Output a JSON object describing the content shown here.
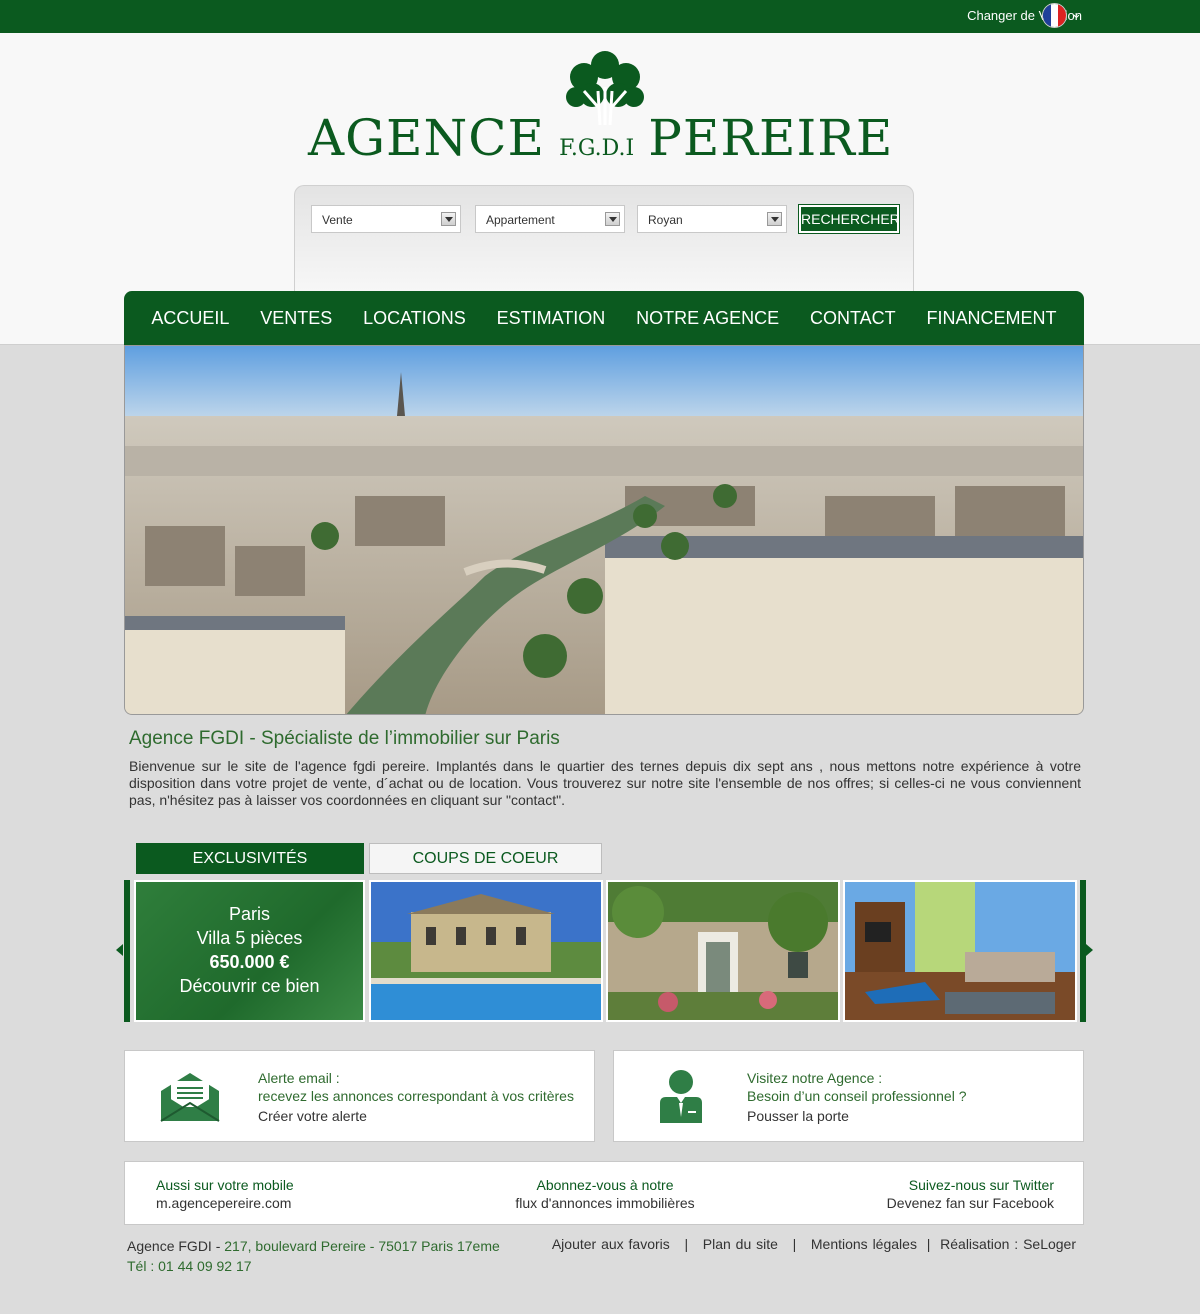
{
  "topbar": {
    "version_label": "Changer de Version"
  },
  "logo": {
    "left": "AGENCE",
    "middle": "F.G.D.I",
    "right": "PEREIRE"
  },
  "search": {
    "transaction": "Vente",
    "property_type": "Appartement",
    "city": "Royan",
    "button": "RECHERCHER"
  },
  "nav": [
    "ACCUEIL",
    "VENTES",
    "LOCATIONS",
    "ESTIMATION",
    "NOTRE AGENCE",
    "CONTACT",
    "FINANCEMENT"
  ],
  "intro": {
    "title": "Agence FGDI - Spécialiste de l’immobilier sur Paris",
    "text": "Bienvenue sur le site de l'agence fgdi pereire. Implantés dans le quartier des ternes depuis dix sept ans , nous mettons notre expérience à votre disposition dans votre projet de vente, d´achat ou de location. Vous trouverez sur notre site l'ensemble de nos offres; si celles-ci ne vous conviennent pas, n'hésitez pas à laisser vos coordonnées en cliquant sur \"contact\"."
  },
  "tabs": {
    "active": "EXCLUSIVITÉS",
    "inactive": "COUPS DE COEUR"
  },
  "featured": {
    "city": "Paris",
    "type": "Villa 5 pièces",
    "price": "650.000 €",
    "cta": "Découvrir ce bien"
  },
  "alert_box": {
    "title": "Alerte email :",
    "line2": "recevez les annonces correspondant à vos critères",
    "line3": "Créer votre alerte"
  },
  "agency_box": {
    "title": "Visitez notre Agence :",
    "line2": "Besoin d’un conseil professionnel ?",
    "line3": "Pousser la porte"
  },
  "strip": {
    "mobile_title": "Aussi sur votre mobile",
    "mobile_url": "m.agencepereire.com",
    "rss_title": "Abonnez-vous à notre",
    "rss_text": "flux d'annonces immobilières",
    "twitter": "Suivez-nous sur Twitter",
    "facebook": "Devenez fan sur Facebook"
  },
  "footer": {
    "agency": "Agence FGDI - ",
    "address": "217, boulevard Pereire - 75017 Paris 17eme",
    "phone": "Tél : 01 44 09 92 17",
    "links": "Ajouter aux favoris   |   Plan du site   |   Mentions légales  |  Réalisation : SeLoger"
  },
  "colors": {
    "brand_green": "#0b5a1f",
    "text_green": "#2f6b2f"
  },
  "icons": [
    "flag-fr-icon",
    "chevron-down-icon",
    "tree-logo-icon",
    "envelope-icon",
    "person-icon",
    "carousel-left-icon",
    "carousel-right-icon"
  ]
}
